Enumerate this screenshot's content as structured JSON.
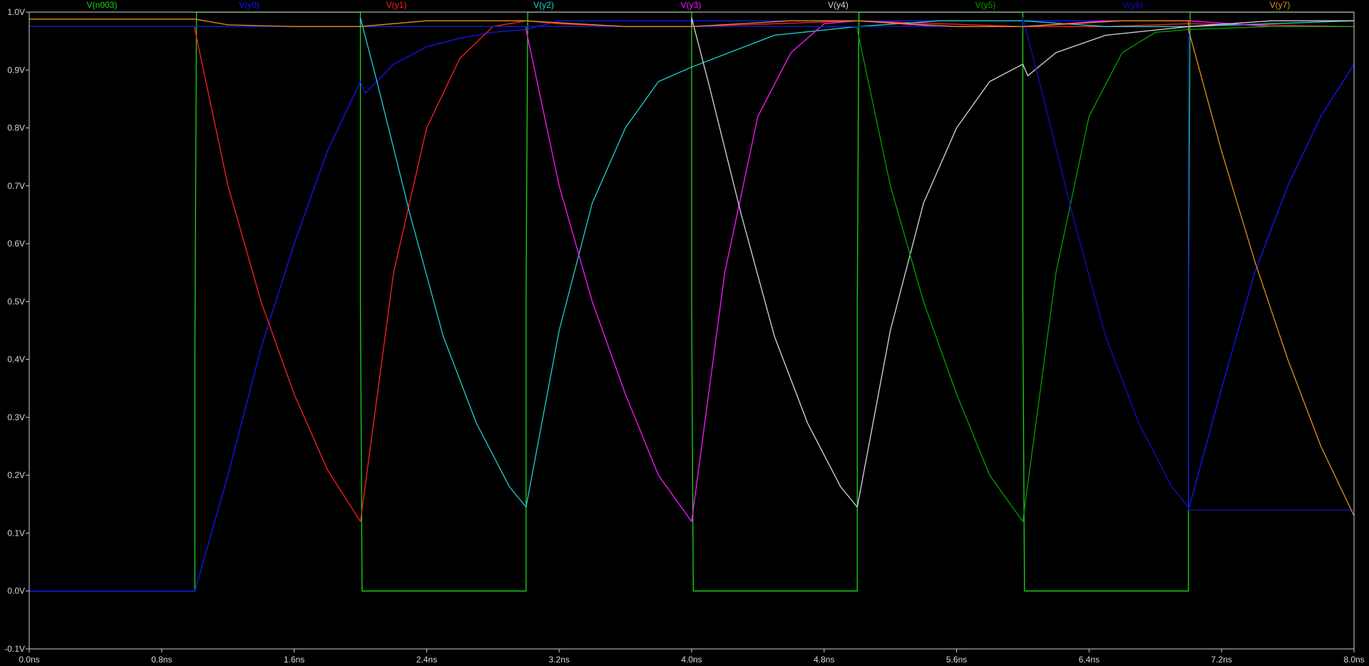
{
  "chart_data": {
    "type": "line",
    "title": "",
    "xlabel": "",
    "ylabel": "",
    "xlim": [
      0.0,
      8.0
    ],
    "ylim": [
      -0.1,
      1.0
    ],
    "grid": false,
    "legend_placement": "top",
    "background": "#000000",
    "axis_color": "#cfcfcf",
    "x_ticks": [
      0.0,
      0.8,
      1.6,
      2.4,
      3.2,
      4.0,
      4.8,
      5.6,
      6.4,
      7.2,
      8.0
    ],
    "x_tick_labels": [
      "0.0ns",
      "0.8ns",
      "1.6ns",
      "2.4ns",
      "3.2ns",
      "4.0ns",
      "4.8ns",
      "5.6ns",
      "6.4ns",
      "7.2ns",
      "8.0ns"
    ],
    "y_ticks": [
      -0.1,
      0.0,
      0.1,
      0.2,
      0.3,
      0.4,
      0.5,
      0.6,
      0.7,
      0.8,
      0.9,
      1.0
    ],
    "y_tick_labels": [
      "-0.1V",
      "0.0V",
      "0.1V",
      "0.2V",
      "0.3V",
      "0.4V",
      "0.5V",
      "0.6V",
      "0.7V",
      "0.8V",
      "0.9V",
      "1.0V"
    ],
    "series": [
      {
        "name": "V(n003)",
        "color": "#18d818",
        "x": [
          0,
          1.0,
          1.0,
          1.01,
          2.0,
          2.0,
          2.01,
          3.0,
          3.0,
          3.01,
          4.0,
          4.0,
          4.01,
          5.0,
          5.0,
          5.01,
          6.0,
          6.0,
          6.01,
          7.0,
          7.0,
          7.01,
          8.0
        ],
        "values": [
          0,
          0,
          0.4,
          1.0,
          1.0,
          0.5,
          0.0,
          0.0,
          0.5,
          1.0,
          1.0,
          0.5,
          0.0,
          0.0,
          0.5,
          1.0,
          1.0,
          0.5,
          0.0,
          0.0,
          0.5,
          1.0,
          1.0
        ]
      },
      {
        "name": "V(y0)",
        "color": "#1414ff",
        "x": [
          0,
          1.0,
          1.2,
          1.4,
          1.6,
          1.8,
          2.0,
          2.03,
          2.2,
          2.4,
          2.6,
          2.8,
          3.0,
          3.2,
          3.6,
          4.0,
          4.5,
          5.0,
          5.5,
          6.0,
          6.5,
          7.0,
          7.0,
          7.2,
          7.4,
          7.6,
          7.8,
          8.0
        ],
        "values": [
          0,
          0,
          0.2,
          0.42,
          0.6,
          0.76,
          0.88,
          0.86,
          0.91,
          0.94,
          0.955,
          0.965,
          0.97,
          0.985,
          0.985,
          0.985,
          0.985,
          0.985,
          0.985,
          0.985,
          0.985,
          0.985,
          0.14,
          0.35,
          0.55,
          0.7,
          0.82,
          0.91
        ]
      },
      {
        "name": "V(y1)",
        "color": "#ff2020",
        "x": [
          0,
          1.0,
          1.0,
          1.2,
          1.4,
          1.6,
          1.8,
          2.0,
          2.0,
          2.2,
          2.4,
          2.6,
          2.8,
          3.0,
          3.2,
          3.6,
          4.0,
          4.5,
          5.0,
          5.5,
          6.0,
          6.5,
          7.0,
          8.0
        ],
        "values": [
          0.975,
          0.975,
          0.97,
          0.7,
          0.5,
          0.34,
          0.21,
          0.12,
          0.12,
          0.55,
          0.8,
          0.92,
          0.975,
          0.985,
          0.98,
          0.975,
          0.975,
          0.98,
          0.985,
          0.98,
          0.975,
          0.975,
          0.98,
          0.975
        ]
      },
      {
        "name": "V(y2)",
        "color": "#20d0d0",
        "x": [
          0,
          1.0,
          2.0,
          2.0,
          2.1,
          2.3,
          2.5,
          2.7,
          2.9,
          3.0,
          3.0,
          3.2,
          3.4,
          3.6,
          3.8,
          4.0,
          4.5,
          5.0,
          5.5,
          6.0,
          6.5,
          7.0,
          7.5,
          8.0
        ],
        "values": [
          0.975,
          0.975,
          0.975,
          0.99,
          0.88,
          0.65,
          0.44,
          0.29,
          0.18,
          0.145,
          0.145,
          0.45,
          0.67,
          0.8,
          0.88,
          0.905,
          0.96,
          0.975,
          0.985,
          0.985,
          0.975,
          0.975,
          0.98,
          0.985
        ]
      },
      {
        "name": "V(y3)",
        "color": "#ff18ff",
        "x": [
          0,
          1.0,
          2.0,
          3.0,
          3.0,
          3.2,
          3.4,
          3.6,
          3.8,
          4.0,
          4.0,
          4.2,
          4.4,
          4.6,
          4.8,
          5.0,
          5.5,
          6.0,
          6.5,
          7.0,
          7.5,
          8.0
        ],
        "values": [
          0.975,
          0.975,
          0.975,
          0.975,
          0.97,
          0.7,
          0.5,
          0.34,
          0.2,
          0.12,
          0.12,
          0.55,
          0.82,
          0.93,
          0.98,
          0.985,
          0.975,
          0.975,
          0.985,
          0.985,
          0.975,
          0.975
        ]
      },
      {
        "name": "V(y4)",
        "color": "#d8d8d8",
        "x": [
          0,
          1.0,
          2.0,
          3.0,
          4.0,
          4.0,
          4.1,
          4.3,
          4.5,
          4.7,
          4.9,
          5.0,
          5.0,
          5.2,
          5.4,
          5.6,
          5.8,
          6.0,
          6.03,
          6.2,
          6.5,
          7.0,
          7.5,
          8.0
        ],
        "values": [
          0.975,
          0.975,
          0.975,
          0.975,
          0.975,
          0.99,
          0.88,
          0.65,
          0.44,
          0.29,
          0.18,
          0.145,
          0.145,
          0.45,
          0.67,
          0.8,
          0.88,
          0.91,
          0.89,
          0.93,
          0.96,
          0.975,
          0.985,
          0.985
        ]
      },
      {
        "name": "V(y5)",
        "color": "#00a000",
        "x": [
          0,
          1.0,
          2.0,
          3.0,
          4.0,
          5.0,
          5.0,
          5.2,
          5.4,
          5.6,
          5.8,
          6.0,
          6.0,
          6.2,
          6.4,
          6.6,
          6.8,
          7.0,
          7.5,
          8.0
        ],
        "values": [
          0.975,
          0.975,
          0.975,
          0.975,
          0.975,
          0.975,
          0.97,
          0.7,
          0.5,
          0.34,
          0.2,
          0.12,
          0.12,
          0.55,
          0.82,
          0.93,
          0.965,
          0.97,
          0.975,
          0.975
        ]
      },
      {
        "name": "V(y6)",
        "color": "#1010c0",
        "x": [
          0,
          1.0,
          2.0,
          3.0,
          4.0,
          5.0,
          6.0,
          6.0,
          6.1,
          6.3,
          6.5,
          6.7,
          6.9,
          7.0,
          7.0,
          7.5,
          8.0
        ],
        "values": [
          0.975,
          0.975,
          0.975,
          0.975,
          0.975,
          0.975,
          0.975,
          0.99,
          0.88,
          0.65,
          0.44,
          0.29,
          0.18,
          0.145,
          0.14,
          0.14,
          0.14
        ]
      },
      {
        "name": "V(y7)",
        "color": "#e09020",
        "x": [
          0,
          1.0,
          1.2,
          1.6,
          2.0,
          2.4,
          3.0,
          3.6,
          4.0,
          4.6,
          5.0,
          5.6,
          6.0,
          6.6,
          7.0,
          7.0,
          7.2,
          7.4,
          7.6,
          7.8,
          8.0
        ],
        "values": [
          0.988,
          0.988,
          0.978,
          0.975,
          0.975,
          0.985,
          0.985,
          0.975,
          0.975,
          0.985,
          0.985,
          0.975,
          0.975,
          0.985,
          0.985,
          0.97,
          0.76,
          0.57,
          0.4,
          0.25,
          0.13
        ]
      }
    ]
  }
}
